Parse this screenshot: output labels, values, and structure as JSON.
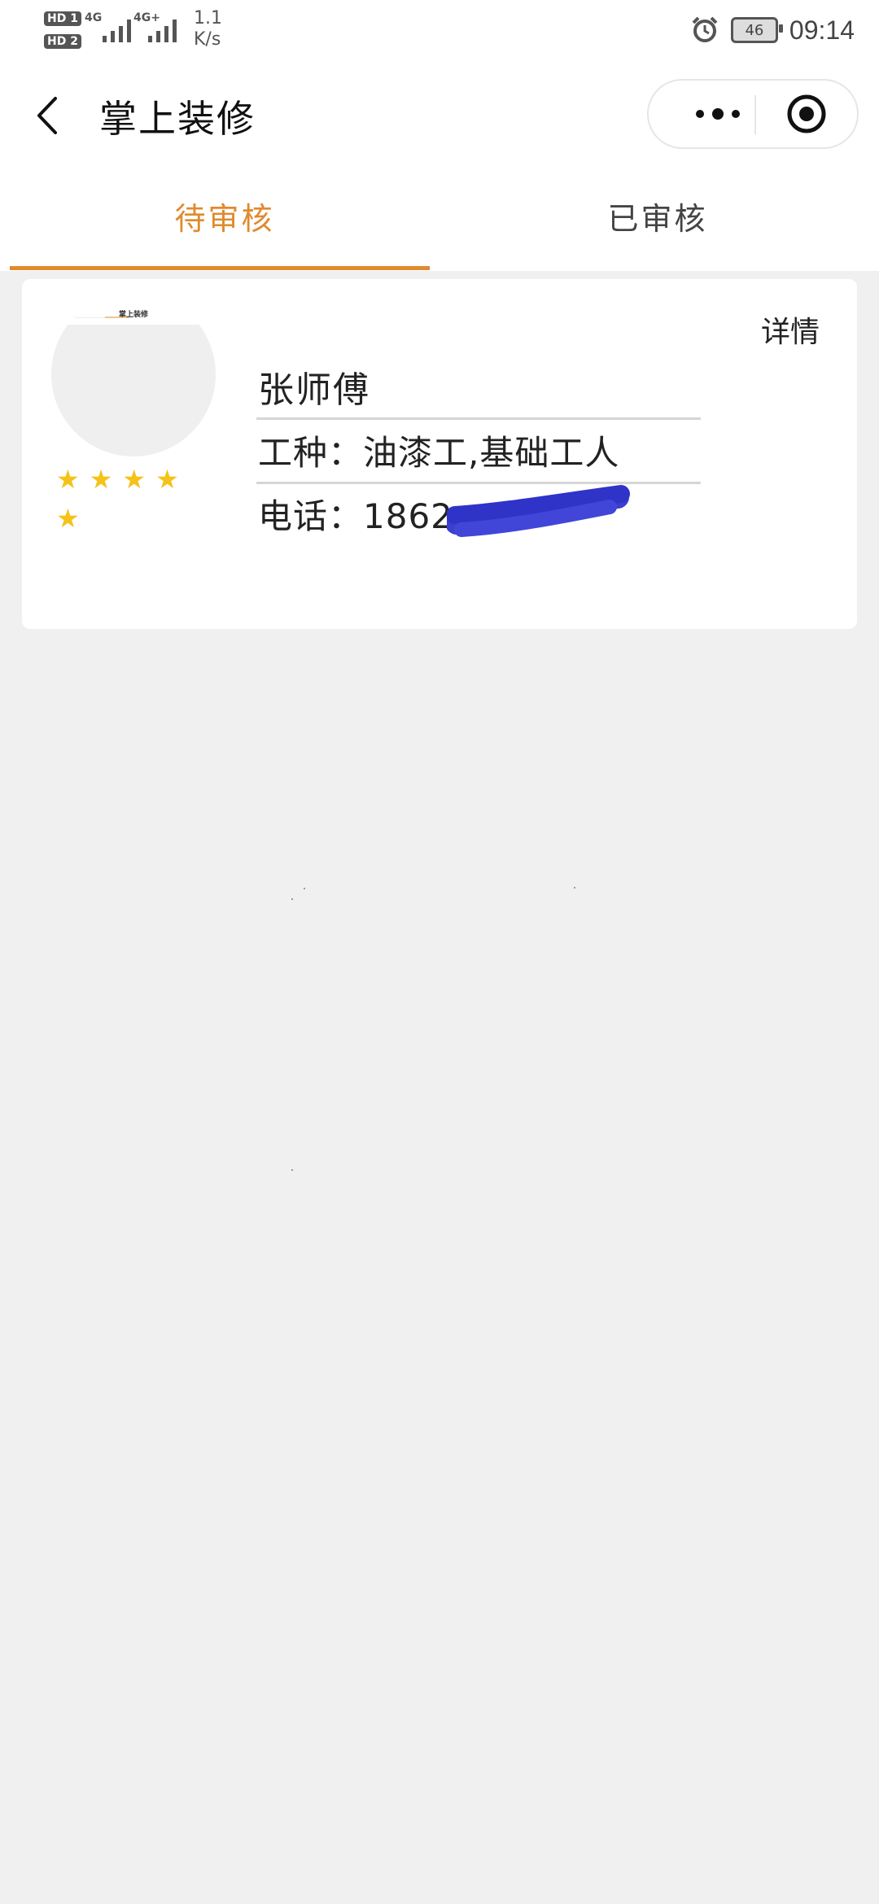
{
  "status_bar": {
    "hd1": "HD 1",
    "hd2": "HD 2",
    "net1": "4G",
    "net2": "4G+",
    "speed_value": "1.1",
    "speed_unit": "K/s",
    "battery": "46",
    "time": "09:14",
    "icons": [
      "alarm-icon",
      "battery-icon",
      "signal-icon"
    ]
  },
  "nav": {
    "title": "掌上装修",
    "icons": [
      "back-arrow-icon",
      "more-dots-icon",
      "target-icon"
    ]
  },
  "tabs": [
    {
      "label": "待审核",
      "active": true
    },
    {
      "label": "已审核",
      "active": false
    }
  ],
  "colors": {
    "accent": "#e08a2e",
    "star": "#f5c218",
    "background": "#f0f0f0",
    "redaction": "#3a3fd0"
  },
  "worker_card": {
    "detail_link": "详情",
    "name": "张师傅",
    "trade": "工种：油漆工,基础工人",
    "phone": "电话：1862",
    "rating": 5,
    "stars_row1": "★★★★",
    "stars_row2": "★"
  }
}
